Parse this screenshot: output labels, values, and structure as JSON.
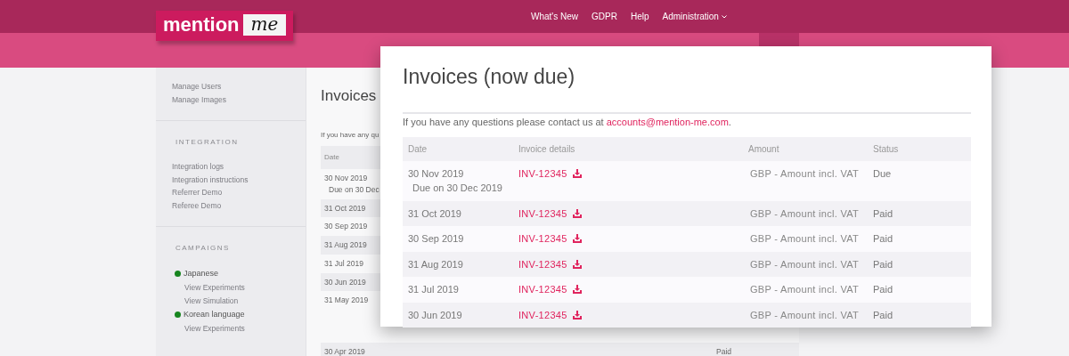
{
  "navbar": {
    "logo": {
      "word": "mention",
      "script": "me"
    },
    "links": [
      {
        "label": "What's New",
        "dropdown": false
      },
      {
        "label": "GDPR",
        "dropdown": false
      },
      {
        "label": "Help",
        "dropdown": false
      },
      {
        "label": "Administration",
        "dropdown": true
      }
    ]
  },
  "sidebar": {
    "sections": [
      {
        "kind": "links",
        "items": [
          "Manage Users",
          "Manage Images"
        ]
      },
      {
        "kind": "links",
        "heading": "INTEGRATION",
        "items": [
          "Integration logs",
          "Integration instructions",
          "Referrer Demo",
          "Referee Demo"
        ]
      },
      {
        "kind": "campaigns",
        "heading": "CAMPAIGNS",
        "campaigns": [
          {
            "name": "Japanese",
            "color": "#17851f",
            "links": [
              "View Experiments",
              "View Simulation"
            ]
          },
          {
            "name": "Korean language",
            "color": "#17851f",
            "links": [
              "View Experiments"
            ]
          }
        ]
      }
    ]
  },
  "page": {
    "title": "Invoices",
    "note": "If you have any qu",
    "table": {
      "columns": [
        "Date"
      ],
      "rows": [
        {
          "date": "30 Nov 2019",
          "due": "Due on 30 Dec"
        },
        {
          "date": "31 Oct 2019"
        },
        {
          "date": "30 Sep 2019"
        },
        {
          "date": "31 Aug 2019"
        },
        {
          "date": "31 Jul 2019"
        },
        {
          "date": "30 Jun 2019"
        },
        {
          "date": "31 May 2019",
          "tall": true
        },
        {
          "date": "30 Apr 2019",
          "status": "Paid"
        }
      ]
    }
  },
  "modal": {
    "title": "Invoices (now due)",
    "note": {
      "text": "If you have any questions please contact us at ",
      "link": "accounts@mention-me.com",
      "after": "."
    },
    "table": {
      "columns": [
        "Date",
        "Invoice details",
        "Amount",
        "Status"
      ],
      "rows": [
        {
          "date": "30 Nov 2019",
          "due": "Due on 30 Dec 2019",
          "invoice": "INV-12345",
          "amount": "GBP - Amount incl. VAT",
          "status": "Due"
        },
        {
          "date": "31 Oct 2019",
          "invoice": "INV-12345",
          "amount": "GBP - Amount incl. VAT",
          "status": "Paid"
        },
        {
          "date": "30 Sep 2019",
          "invoice": "INV-12345",
          "amount": "GBP - Amount incl. VAT",
          "status": "Paid"
        },
        {
          "date": "31 Aug 2019",
          "invoice": "INV-12345",
          "amount": "GBP - Amount incl. VAT",
          "status": "Paid"
        },
        {
          "date": "31 Jul 2019",
          "invoice": "INV-12345",
          "amount": "GBP - Amount incl. VAT",
          "status": "Paid"
        },
        {
          "date": "30 Jun 2019",
          "invoice": "INV-12345",
          "amount": "GBP - Amount incl. VAT",
          "status": "Paid"
        }
      ]
    }
  }
}
